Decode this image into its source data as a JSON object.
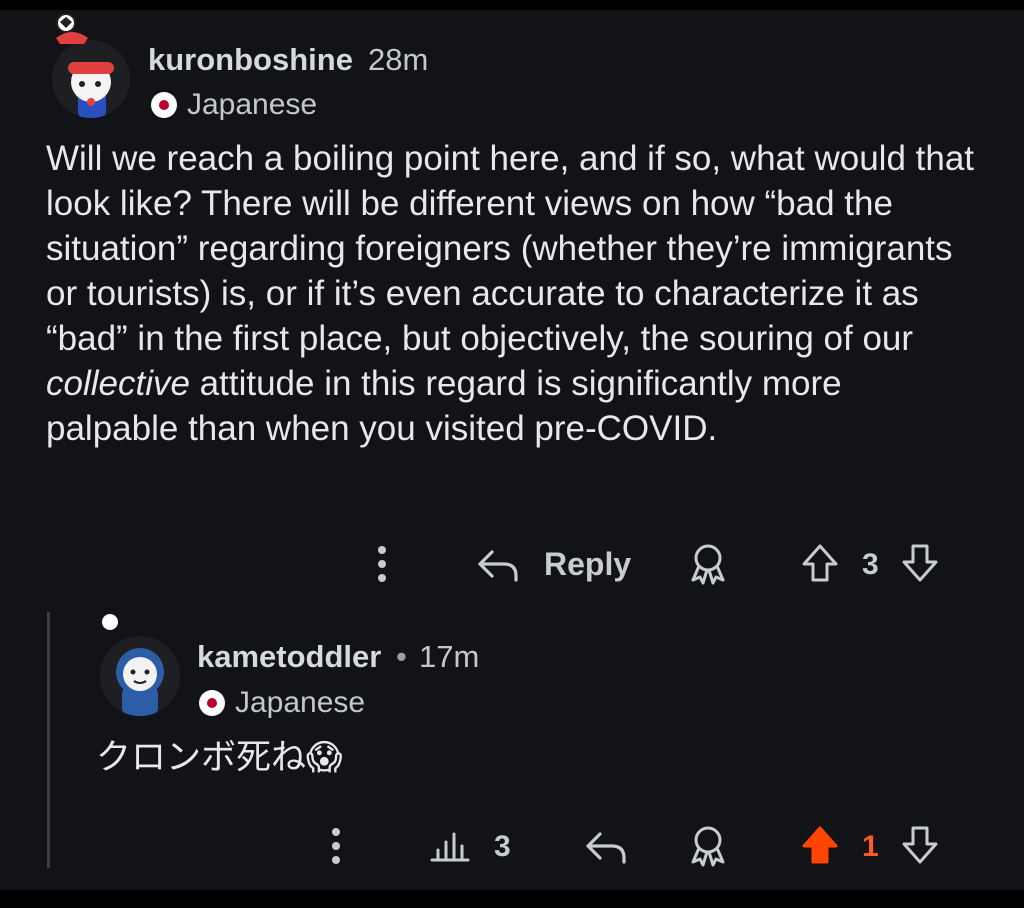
{
  "comment": {
    "username": "kuronboshine",
    "time": "28m",
    "flair": "Japanese",
    "body_parts": [
      {
        "text": "Will we reach a boiling point here, and if so, what would that look like? There will be different views on how “bad the situation” regarding foreigners (whether they’re immigrants or tourists) is, or if it’s even accurate to characterize it as “bad” in the first place, but objectively, the souring of our "
      },
      {
        "text": "collective",
        "italic": true
      },
      {
        "text": " attitude in this regard is significantly more palpable than when you visited pre-COVID."
      }
    ],
    "reply_label": "Reply",
    "vote_count": "3"
  },
  "reply": {
    "username": "kametoddler",
    "separator": "•",
    "time": "17m",
    "flair": "Japanese",
    "body": "クロンボ死ね😱",
    "stats_count": "3",
    "vote_count": "1"
  },
  "icons": [
    "more-icon",
    "reply-arrow-icon",
    "award-icon",
    "upvote-icon",
    "downvote-icon",
    "stats-icon"
  ],
  "colors": {
    "background": "#121317",
    "upvote_active": "#ff4500",
    "vote_active_text": "#ff5a24",
    "flag_red": "#bc002d"
  }
}
